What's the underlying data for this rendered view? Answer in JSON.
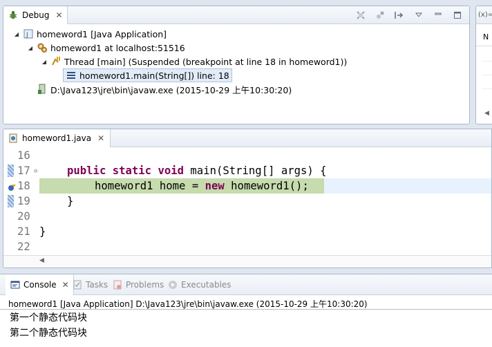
{
  "debug_view": {
    "tab_label": "Debug",
    "tree": {
      "launch": "homeword1 [Java Application]",
      "target": "homeword1 at localhost:51516",
      "thread": "Thread [main] (Suspended (breakpoint at line 18 in homeword1))",
      "frame": "homeword1.main(String[]) line: 18",
      "process": "D:\\Java123\\jre\\bin\\javaw.exe (2015-10-29 上午10:30:20)"
    }
  },
  "variables_view": {
    "tab_label": "(x)=",
    "column_label": "N"
  },
  "editor": {
    "tab_label": "homeword1.java",
    "lines": [
      {
        "num": "16",
        "code": ""
      },
      {
        "num": "17",
        "code": "public static void main(String[] args) {"
      },
      {
        "num": "18",
        "code": "homeword1 home = new homeword1();"
      },
      {
        "num": "19",
        "code": "}"
      },
      {
        "num": "20",
        "code": ""
      },
      {
        "num": "21",
        "code": "}"
      },
      {
        "num": "22",
        "code": ""
      }
    ],
    "current_line": "18"
  },
  "console_view": {
    "tabs": [
      {
        "label": "Console",
        "active": true
      },
      {
        "label": "Tasks",
        "active": false
      },
      {
        "label": "Problems",
        "active": false
      },
      {
        "label": "Executables",
        "active": false
      }
    ],
    "process_header": "homeword1 [Java Application] D:\\Java123\\jre\\bin\\javaw.exe (2015-10-29 上午10:30:20)",
    "output": [
      "第一个静态代码块",
      "第二个静态代码块"
    ]
  },
  "icons": {
    "debug": "debug-bug-icon",
    "remove_launches": "remove-all-terminated-icon",
    "skip_breakpoints": "skip-breakpoints-icon",
    "step_filters": "use-step-filters-icon",
    "view_menu": "view-menu-icon",
    "minimize": "minimize-icon",
    "maximize": "maximize-icon"
  },
  "colors": {
    "keyword": "#7f0055",
    "current_line_highlight": "#c6dbae",
    "line_highlight": "#e8f2fe",
    "line_number": "#787878"
  }
}
